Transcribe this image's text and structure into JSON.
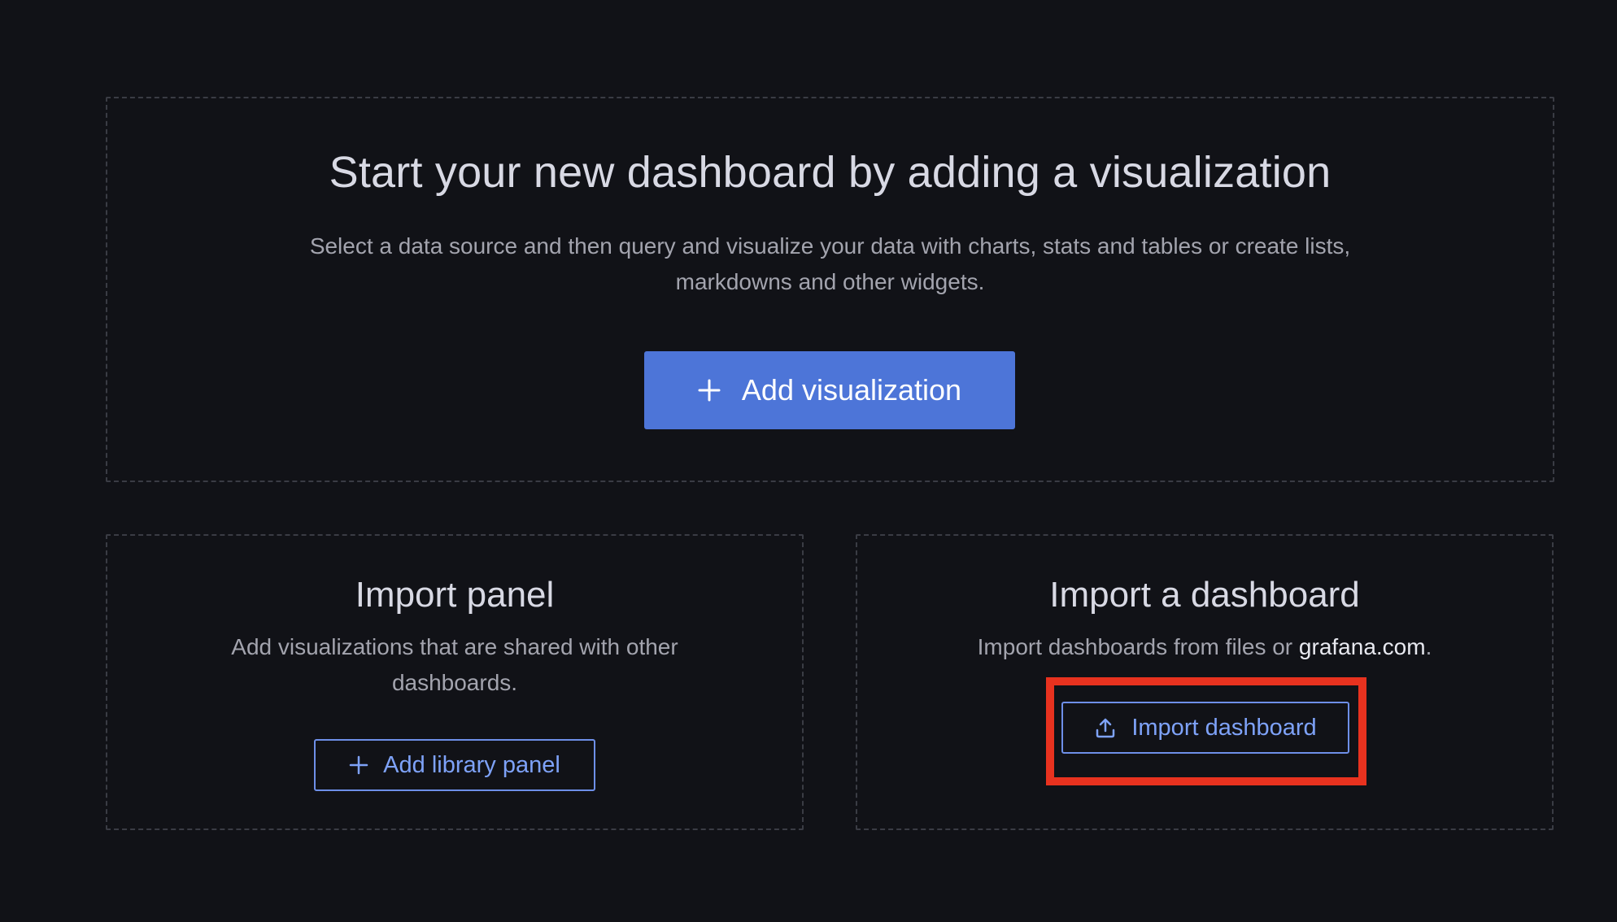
{
  "hero": {
    "title": "Start your new dashboard by adding a visualization",
    "description": "Select a data source and then query and visualize your data with charts, stats and tables or create lists, markdowns and other widgets.",
    "add_visualization_label": "Add visualization",
    "button_icon": "plus-icon"
  },
  "import_panel": {
    "title": "Import panel",
    "description": "Add visualizations that are shared with other dashboards.",
    "button_label": "Add library panel",
    "button_icon": "plus-icon"
  },
  "import_dashboard": {
    "title": "Import a dashboard",
    "description_prefix": "Import dashboards from files or ",
    "link_text": "grafana.com",
    "description_suffix": ".",
    "button_label": "Import dashboard",
    "button_icon": "upload-icon",
    "highlight_color": "#e8321f"
  },
  "colors": {
    "background": "#111217",
    "primary_button": "#4d75d8",
    "outline_button": "#6e8fe8"
  }
}
